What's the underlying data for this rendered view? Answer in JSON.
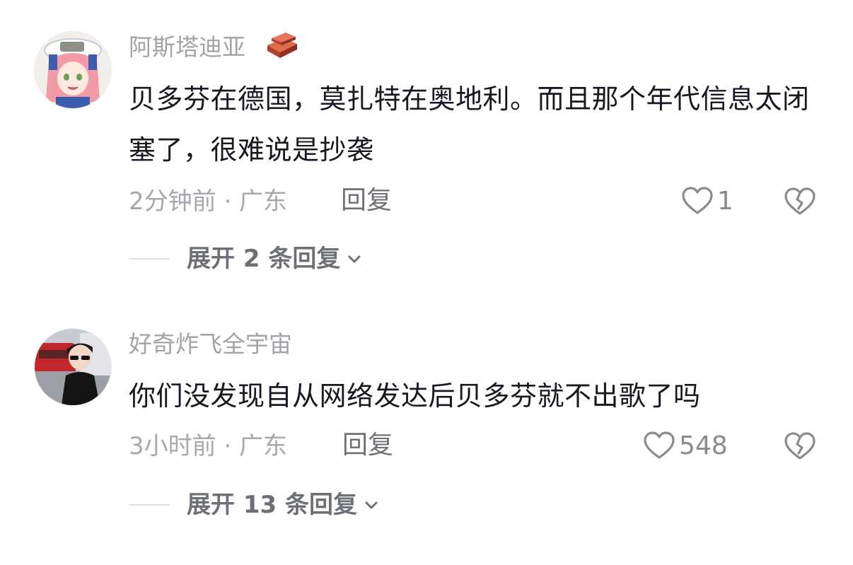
{
  "comments": [
    {
      "username": "阿斯塔迪亚",
      "text": "贝多芬在德国，莫扎特在奥地利。而且那个年代信息太闭塞了，很难说是抄袭",
      "meta": "2分钟前 · 广东",
      "reply_label": "回复",
      "likes": "1",
      "expand_label": "展开 2 条回复",
      "badge_icon": "brick-badge-icon",
      "avatar_icon": "anime-girl-avatar"
    },
    {
      "username": "好奇炸飞全宇宙",
      "text": "你们没发现自从网络发达后贝多芬就不出歌了吗",
      "meta": "3小时前 · 广东",
      "reply_label": "回复",
      "likes": "548",
      "expand_label": "展开 13 条回复",
      "avatar_icon": "sunglasses-man-avatar"
    }
  ],
  "colors": {
    "text_primary": "#161823",
    "text_secondary": "#a7a8ad",
    "action": "#6e7077",
    "icon_stroke": "#8a8b91",
    "badge": "#c0452e"
  }
}
